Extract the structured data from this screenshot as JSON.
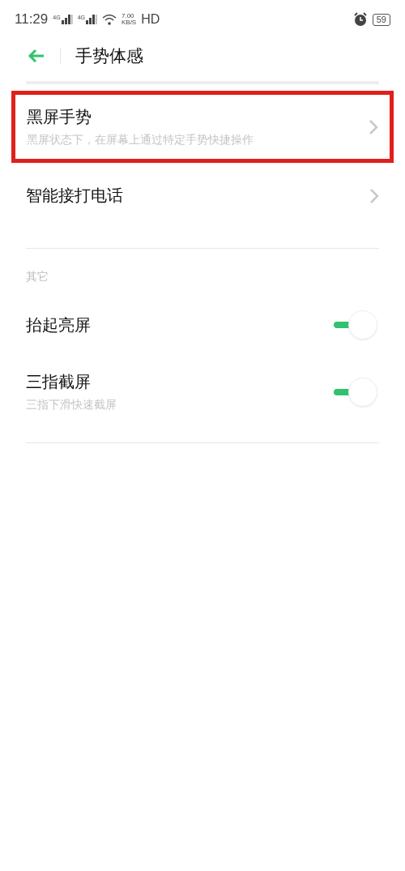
{
  "status_bar": {
    "time": "11:29",
    "sim_labels": [
      "4G",
      "4G"
    ],
    "speed_value": "7.00",
    "speed_unit": "KB/S",
    "hd": "HD",
    "battery": "59"
  },
  "header": {
    "title": "手势体感"
  },
  "items": [
    {
      "kind": "link",
      "title": "黑屏手势",
      "subtitle": "黑屏状态下，在屏幕上通过特定手势快捷操作",
      "highlighted": true
    },
    {
      "kind": "link",
      "title": "智能接打电话",
      "highlighted": false
    }
  ],
  "section": {
    "label": "其它"
  },
  "toggles": [
    {
      "kind": "toggle",
      "title": "抬起亮屏",
      "on": true
    },
    {
      "kind": "toggle",
      "title": "三指截屏",
      "subtitle": "三指下滑快速截屏",
      "on": true
    }
  ]
}
